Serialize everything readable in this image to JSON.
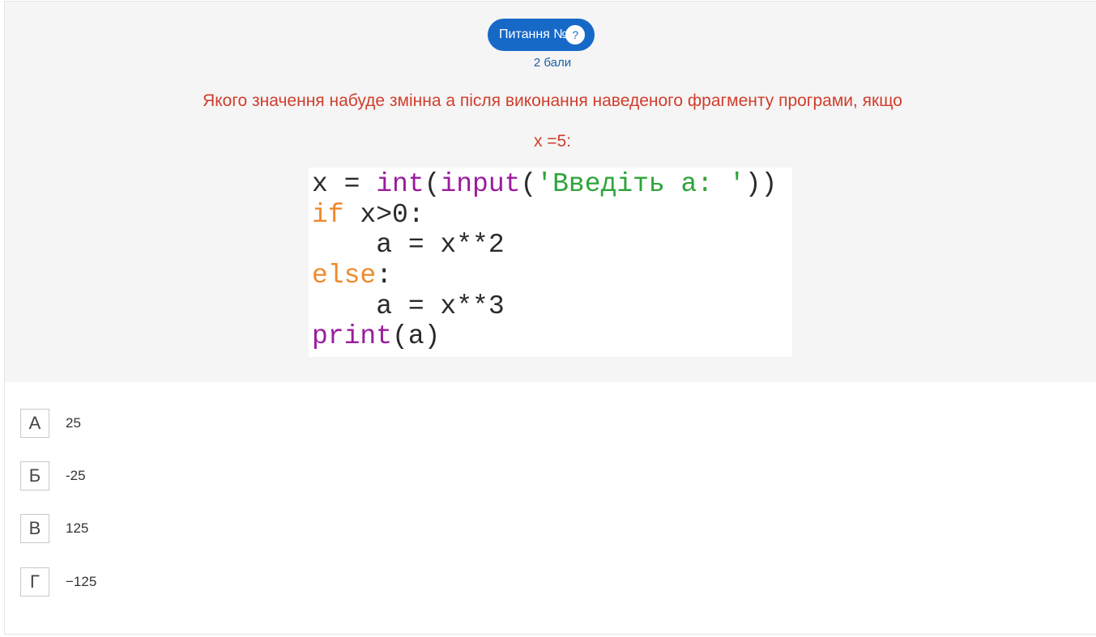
{
  "question": {
    "badge_label": "Питання №6",
    "help_glyph": "?",
    "points": "2 бали",
    "text": "Якого значення набуде змінна а після виконання наведеного фрагменту програми, якщо",
    "condition": "x =5:"
  },
  "code": {
    "lines": [
      [
        {
          "t": "x = ",
          "c": "plain"
        },
        {
          "t": "int",
          "c": "purple"
        },
        {
          "t": "(",
          "c": "plain"
        },
        {
          "t": "input",
          "c": "purple"
        },
        {
          "t": "(",
          "c": "plain"
        },
        {
          "t": "'Введіть a: '",
          "c": "green"
        },
        {
          "t": "))",
          "c": "plain"
        }
      ],
      [
        {
          "t": "if",
          "c": "orange"
        },
        {
          "t": " x>0:",
          "c": "plain"
        }
      ],
      [
        {
          "t": "    a = x**2",
          "c": "plain"
        }
      ],
      [
        {
          "t": "else",
          "c": "orange"
        },
        {
          "t": ":",
          "c": "plain"
        }
      ],
      [
        {
          "t": "    a = x**3",
          "c": "plain"
        }
      ],
      [
        {
          "t": "print",
          "c": "purple"
        },
        {
          "t": "(a)",
          "c": "plain"
        }
      ]
    ]
  },
  "answers": [
    {
      "letter": "А",
      "value": "25"
    },
    {
      "letter": "Б",
      "value": "-25"
    },
    {
      "letter": "В",
      "value": "125"
    },
    {
      "letter": "Г",
      "value": "−125"
    }
  ],
  "colors": {
    "badge_bg": "#1769c8",
    "question_text": "#d13d2c",
    "points_text": "#1d5fa8",
    "panel_bg": "#f5f5f5",
    "code_keyword_purple": "#9a1c9e",
    "code_keyword_orange": "#ef8a2d",
    "code_string_green": "#2ea43a"
  },
  "icons": {
    "help": "question-circle-icon"
  }
}
